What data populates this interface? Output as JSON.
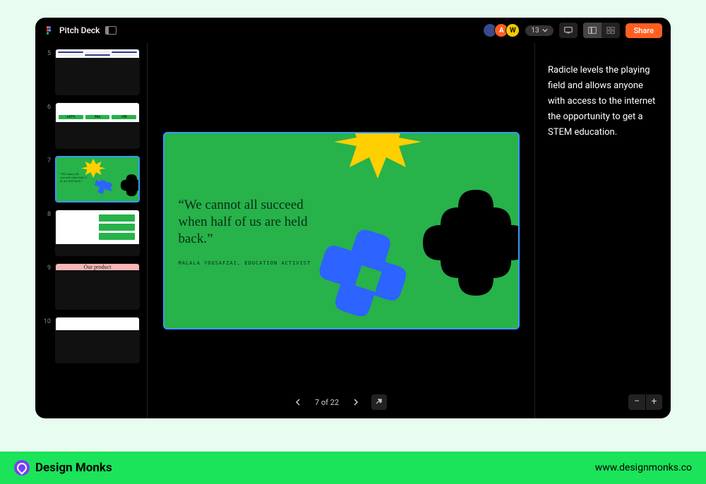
{
  "titlebar": {
    "doc_title": "Pitch Deck",
    "share_label": "Share",
    "extra_count": "13"
  },
  "avatars": [
    {
      "bg": "#374b8c",
      "color": "#fff",
      "initial": ""
    },
    {
      "bg": "#ff5f1f",
      "color": "#fff",
      "initial": "A"
    },
    {
      "bg": "#f5c900",
      "color": "#000",
      "initial": "W"
    }
  ],
  "thumbs": [
    {
      "num": "5"
    },
    {
      "num": "6",
      "chips": [
        "+47%",
        "96x",
        ">5K"
      ]
    },
    {
      "num": "7"
    },
    {
      "num": "8"
    },
    {
      "num": "9",
      "label": "Our product"
    },
    {
      "num": "10"
    }
  ],
  "slide": {
    "quote": "“We cannot all succeed when half of us are held back.”",
    "attribution": "MALALA YOUSAFZAI, EDUCATION ACTIVIST",
    "badge": ""
  },
  "pager": {
    "label": "7 of 22"
  },
  "notes": {
    "text": "Radicle levels the playing field and allows anyone with access to the internet the opportunity to get a STEM education."
  },
  "brand": {
    "name": "Design Monks",
    "url": "www.designmonks.co"
  }
}
